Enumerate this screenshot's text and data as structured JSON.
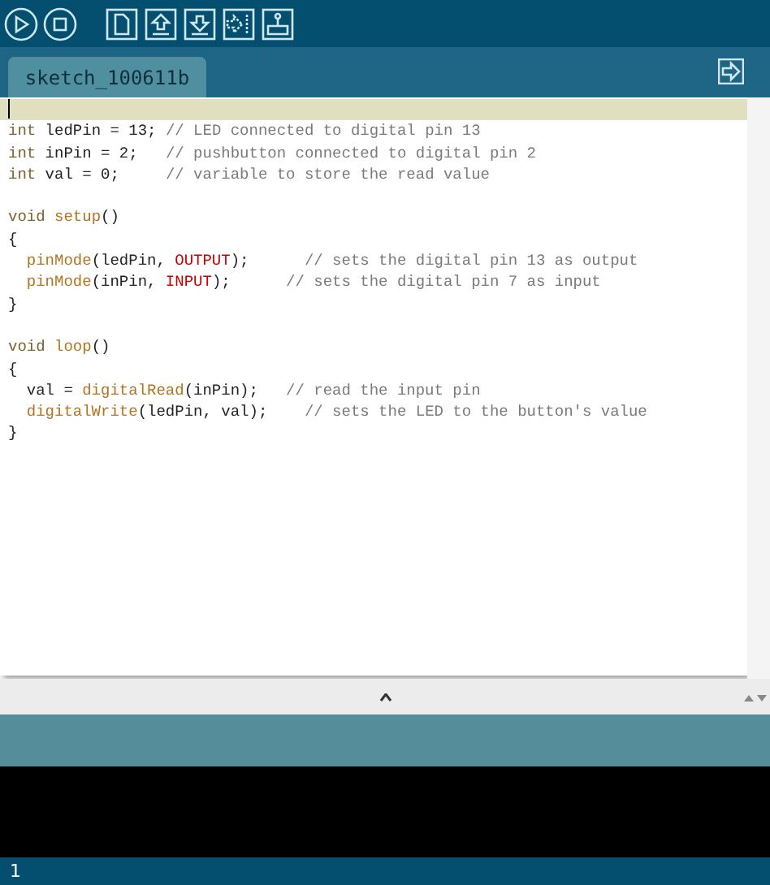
{
  "toolbar": {
    "buttons": [
      {
        "kind": "run"
      },
      {
        "kind": "stop"
      },
      {
        "kind": "new"
      },
      {
        "kind": "open"
      },
      {
        "kind": "save"
      },
      {
        "kind": "upload"
      },
      {
        "kind": "monitor"
      }
    ]
  },
  "tabs": [
    {
      "label": "sketch_100611b",
      "selected": true
    }
  ],
  "editor": {
    "lines": [
      {
        "kind": "cursor"
      },
      {
        "kind": "code",
        "tokens": [
          {
            "kind": "type",
            "text": "int"
          },
          {
            "kind": "plain",
            "text": " ledPin = 13; "
          },
          {
            "kind": "comment",
            "text": "// LED connected to digital pin 13"
          }
        ]
      },
      {
        "kind": "code",
        "tokens": [
          {
            "kind": "type",
            "text": "int"
          },
          {
            "kind": "plain",
            "text": " inPin = 2;   "
          },
          {
            "kind": "comment",
            "text": "// pushbutton connected to digital pin 2"
          }
        ]
      },
      {
        "kind": "code",
        "tokens": [
          {
            "kind": "type",
            "text": "int"
          },
          {
            "kind": "plain",
            "text": " val = 0;     "
          },
          {
            "kind": "comment",
            "text": "// variable to store the read value"
          }
        ]
      },
      {
        "kind": "blank"
      },
      {
        "kind": "code",
        "tokens": [
          {
            "kind": "type",
            "text": "void "
          },
          {
            "kind": "func",
            "text": "setup"
          },
          {
            "kind": "plain",
            "text": "()"
          }
        ]
      },
      {
        "kind": "code",
        "tokens": [
          {
            "kind": "plain",
            "text": "{"
          }
        ]
      },
      {
        "kind": "code",
        "tokens": [
          {
            "kind": "func",
            "text": "  pinMode"
          },
          {
            "kind": "plain",
            "text": "(ledPin, "
          },
          {
            "kind": "const",
            "text": "OUTPUT"
          },
          {
            "kind": "plain",
            "text": ");      "
          },
          {
            "kind": "comment",
            "text": "// sets the digital pin 13 as output"
          }
        ]
      },
      {
        "kind": "code",
        "tokens": [
          {
            "kind": "func",
            "text": "  pinMode"
          },
          {
            "kind": "plain",
            "text": "(inPin, "
          },
          {
            "kind": "const",
            "text": "INPUT"
          },
          {
            "kind": "plain",
            "text": ");      "
          },
          {
            "kind": "comment",
            "text": "// sets the digital pin 7 as input"
          }
        ]
      },
      {
        "kind": "code",
        "tokens": [
          {
            "kind": "plain",
            "text": "}"
          }
        ]
      },
      {
        "kind": "blank"
      },
      {
        "kind": "code",
        "tokens": [
          {
            "kind": "type",
            "text": "void "
          },
          {
            "kind": "func",
            "text": "loop"
          },
          {
            "kind": "plain",
            "text": "()"
          }
        ]
      },
      {
        "kind": "code",
        "tokens": [
          {
            "kind": "plain",
            "text": "{"
          }
        ]
      },
      {
        "kind": "code",
        "tokens": [
          {
            "kind": "plain",
            "text": "  val = "
          },
          {
            "kind": "func",
            "text": "digitalRead"
          },
          {
            "kind": "plain",
            "text": "(inPin);   "
          },
          {
            "kind": "comment",
            "text": "// read the input pin"
          }
        ]
      },
      {
        "kind": "code",
        "tokens": [
          {
            "kind": "func",
            "text": "  digitalWrite"
          },
          {
            "kind": "plain",
            "text": "(ledPin, val);    "
          },
          {
            "kind": "comment",
            "text": "// sets the LED to the button's value"
          }
        ]
      },
      {
        "kind": "code",
        "tokens": [
          {
            "kind": "plain",
            "text": "}"
          }
        ]
      }
    ]
  },
  "footer": {
    "line_number": "1"
  }
}
